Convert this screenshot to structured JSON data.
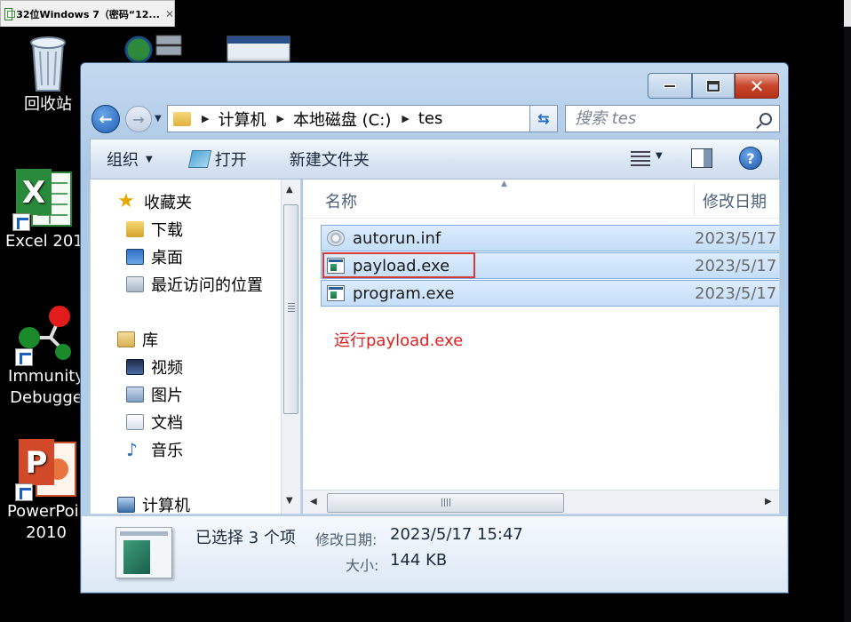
{
  "vm_tab": {
    "title": "32位Windows 7（密码“12...",
    "close": "✕"
  },
  "desktop": {
    "icons": [
      {
        "id": "recycle",
        "label": "回收站"
      },
      {
        "id": "network",
        "label": ""
      },
      {
        "id": "window-app",
        "label": ""
      },
      {
        "id": "excel",
        "label": "Excel 201"
      },
      {
        "id": "immunity",
        "label_line1": "Immunity",
        "label_line2": "Debugge"
      },
      {
        "id": "powerpoint",
        "label_line1": "PowerPoir",
        "label_line2": "2010"
      }
    ]
  },
  "window": {
    "address": {
      "crumbs": [
        "计算机",
        "本地磁盘 (C:)",
        "tes"
      ]
    },
    "search": {
      "placeholder": "搜索 tes"
    },
    "commands": {
      "organize": "组织",
      "open": "打开",
      "new_folder": "新建文件夹"
    },
    "nav": {
      "favorites": "收藏夹",
      "downloads": "下载",
      "desktop": "桌面",
      "recent": "最近访问的位置",
      "libraries": "库",
      "videos": "视频",
      "pictures": "图片",
      "documents": "文档",
      "music": "音乐",
      "computer": "计算机"
    },
    "columns": {
      "name": "名称",
      "date_modified": "修改日期"
    },
    "files": [
      {
        "name": "autorun.inf",
        "date": "2023/5/17",
        "icon": "settings-file-icon"
      },
      {
        "name": "payload.exe",
        "date": "2023/5/17",
        "icon": "exe-icon"
      },
      {
        "name": "program.exe",
        "date": "2023/5/17",
        "icon": "exe-icon"
      }
    ],
    "annotation": "运行payload.exe",
    "details": {
      "selection": "已选择 3 个项",
      "modified_label": "修改日期:",
      "modified_value": "2023/5/17 15:47",
      "size_label": "大小:",
      "size_value": "144 KB"
    }
  },
  "colors": {
    "annotation": "#e02020",
    "selection_row": "#c4def8",
    "close_button": "#c7452b"
  }
}
